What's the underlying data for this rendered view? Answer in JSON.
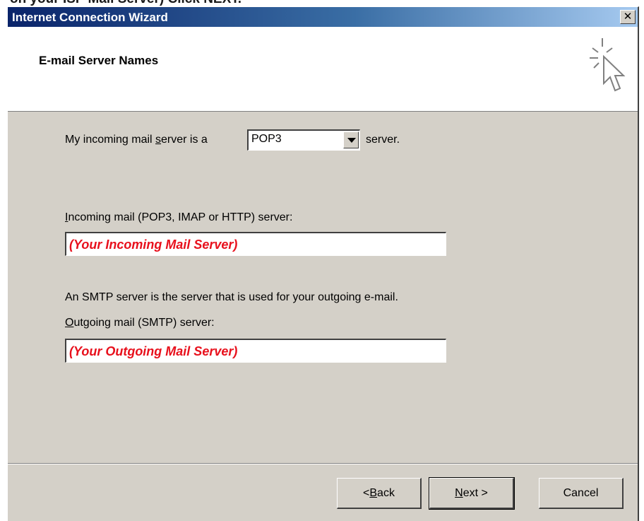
{
  "page_caption": "on your ISP Mail Server) Click NEXT.",
  "window": {
    "title": "Internet Connection Wizard",
    "close_glyph": "✕"
  },
  "header": {
    "heading": "E-mail Server Names",
    "icon": "wizard-pointer-icon"
  },
  "content": {
    "server_type_prefix": "My incoming mail ",
    "server_type_prefix_mnemonic": "s",
    "server_type_prefix_rest": "erver is a",
    "server_type_value": "POP3",
    "server_type_suffix": "server.",
    "incoming_label_mnemonic": "I",
    "incoming_label_rest": "ncoming mail (POP3, IMAP or HTTP) server:",
    "incoming_value": "(Your Incoming Mail Server)",
    "smtp_note": "An SMTP server is the server that is used for your outgoing e-mail.",
    "outgoing_label_mnemonic": "O",
    "outgoing_label_rest": "utgoing mail (SMTP) server:",
    "outgoing_value": "(Your Outgoing Mail Server)"
  },
  "buttons": {
    "back_prefix": "< ",
    "back_mnemonic": "B",
    "back_rest": "ack",
    "next_mnemonic": "N",
    "next_rest": "ext >",
    "cancel": "Cancel"
  },
  "colors": {
    "titlebar_start": "#0a246a",
    "titlebar_end": "#a6caf0",
    "dialog_face": "#d4d0c8",
    "field_text": "#e8101c"
  }
}
